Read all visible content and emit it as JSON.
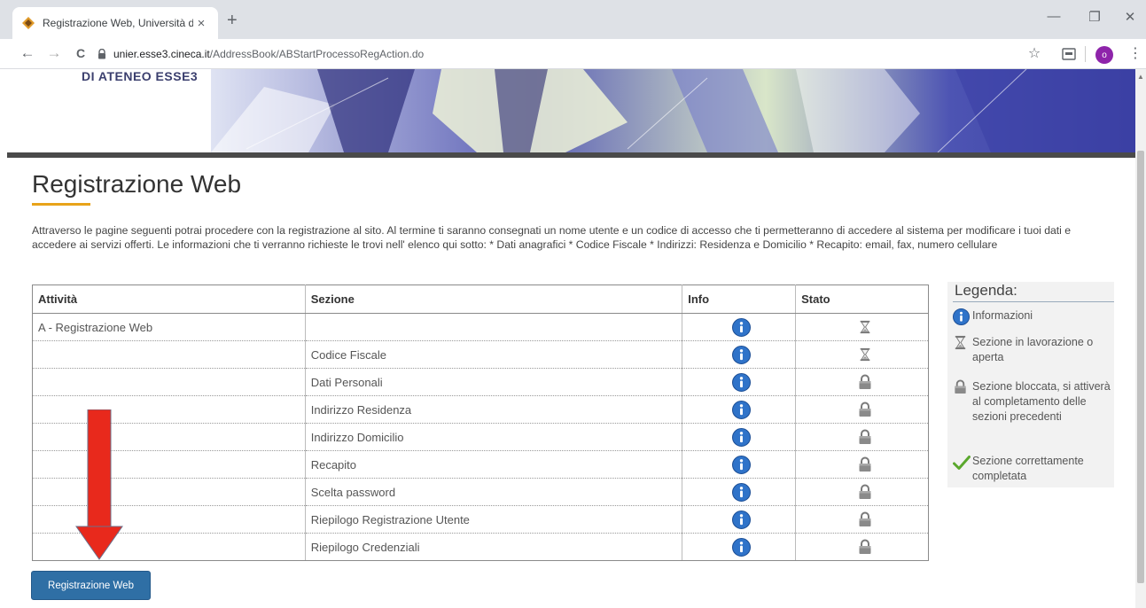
{
  "browser": {
    "tab_title": "Registrazione Web, Università d",
    "tab_close": "×",
    "new_tab": "+",
    "url_host": "unier.esse3.cineca.it",
    "url_path": "/AddressBook/ABStartProcessoRegAction.do",
    "window_controls": [
      "—",
      "❐",
      "✕"
    ],
    "nav": {
      "back": "←",
      "forward": "→",
      "reload": "C"
    },
    "profile_initial": "o"
  },
  "banner": {
    "title": "DI ATENEO ESSE3"
  },
  "page": {
    "title": "Registrazione Web",
    "intro": "Attraverso le pagine seguenti potrai procedere con la registrazione al sito. Al termine ti saranno consegnati un nome utente e un codice di accesso che ti permetteranno di accedere al sistema per modificare i tuoi dati e accedere ai servizi offerti. Le informazioni che ti verranno richieste le trovi nell' elenco qui sotto: * Dati anagrafici * Codice Fiscale * Indirizzi: Residenza e Domicilio * Recapito: email, fax, numero cellulare"
  },
  "table": {
    "headers": [
      "Attività",
      "Sezione",
      "Info",
      "Stato"
    ],
    "rows": [
      {
        "attivita": "A - Registrazione Web",
        "sezione": "",
        "stato": "hourglass-icon"
      },
      {
        "attivita": "",
        "sezione": "Codice Fiscale",
        "stato": "hourglass-icon"
      },
      {
        "attivita": "",
        "sezione": "Dati Personali",
        "stato": "lock-icon"
      },
      {
        "attivita": "",
        "sezione": "Indirizzo Residenza",
        "stato": "lock-icon"
      },
      {
        "attivita": "",
        "sezione": "Indirizzo Domicilio",
        "stato": "lock-icon"
      },
      {
        "attivita": "",
        "sezione": "Recapito",
        "stato": "lock-icon"
      },
      {
        "attivita": "",
        "sezione": "Scelta password",
        "stato": "lock-icon"
      },
      {
        "attivita": "",
        "sezione": "Riepilogo Registrazione Utente",
        "stato": "lock-icon"
      },
      {
        "attivita": "",
        "sezione": "Riepilogo Credenziali",
        "stato": "lock-icon"
      }
    ]
  },
  "legend": {
    "title": "Legenda:",
    "items": [
      {
        "icon": "info-icon",
        "text": "Informazioni"
      },
      {
        "icon": "hourglass-icon",
        "text": "Sezione in lavorazione o aperta"
      },
      {
        "icon": "lock-icon",
        "text": "Sezione bloccata, si attiverà al completamento delle sezioni precedenti"
      },
      {
        "icon": "checkmark-icon",
        "text": "Sezione correttamente completata"
      }
    ]
  },
  "button": {
    "label": "Registrazione Web"
  },
  "colors": {
    "button_bg": "#2f6fa5",
    "arrow": "#e8291c",
    "info_blue": "#2f73c9",
    "accent_underline": "#e8a319"
  }
}
